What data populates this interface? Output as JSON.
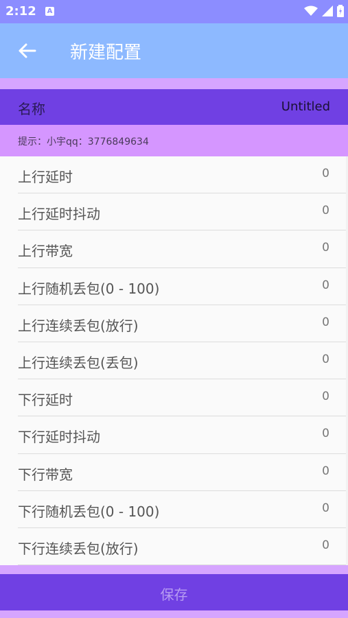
{
  "status_bar": {
    "time": "2:12",
    "notification_icon": "A"
  },
  "app_bar": {
    "title": "新建配置",
    "back_icon": "arrow-left-icon"
  },
  "name_field": {
    "label": "名称",
    "value": "Untitled"
  },
  "hint": {
    "text": "提示：小宇qq：3776849634"
  },
  "settings": [
    {
      "label": "上行延时",
      "value": "0"
    },
    {
      "label": "上行延时抖动",
      "value": "0"
    },
    {
      "label": "上行带宽",
      "value": "0"
    },
    {
      "label": "上行随机丢包(0 - 100)",
      "value": "0"
    },
    {
      "label": "上行连续丢包(放行)",
      "value": "0"
    },
    {
      "label": "上行连续丢包(丢包)",
      "value": "0"
    },
    {
      "label": "下行延时",
      "value": "0"
    },
    {
      "label": "下行延时抖动",
      "value": "0"
    },
    {
      "label": "下行带宽",
      "value": "0"
    },
    {
      "label": "下行随机丢包(0 - 100)",
      "value": "0"
    },
    {
      "label": "下行连续丢包(放行)",
      "value": "0"
    }
  ],
  "save_button": {
    "label": "保存"
  },
  "colors": {
    "status_bar": "#8c8dff",
    "app_bar": "#8db9ff",
    "name_row": "#7040e3",
    "hint_bg": "#d596ff",
    "save_button": "#7040e3"
  }
}
